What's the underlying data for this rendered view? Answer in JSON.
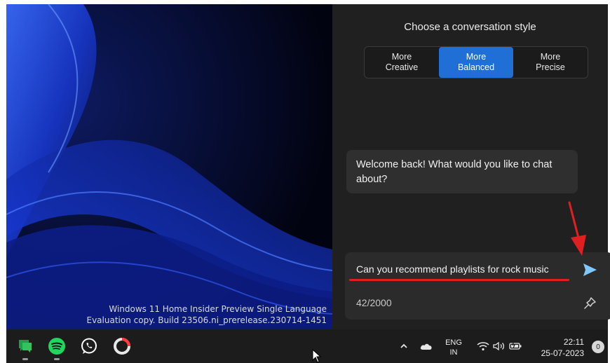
{
  "wallpaper": {
    "watermark_line1": "Windows 11 Home Insider Preview Single Language",
    "watermark_line2": "Evaluation copy. Build 23506.ni_prerelease.230714-1451"
  },
  "copilot": {
    "style_title": "Choose a conversation style",
    "styles": [
      {
        "line1": "More",
        "line2": "Creative",
        "active": false
      },
      {
        "line1": "More",
        "line2": "Balanced",
        "active": true
      },
      {
        "line1": "More",
        "line2": "Precise",
        "active": false
      }
    ],
    "message": "Welcome back! What would you like to chat about?",
    "input_value": "Can you recommend playlists for rock music",
    "char_count": "42/2000",
    "accent_color": "#1f6fd6",
    "annotation_color": "#e02020"
  },
  "taskbar": {
    "apps": [
      "google-chat-icon",
      "spotify-icon",
      "whatsapp-icon",
      "opera-icon"
    ],
    "lang_line1": "ENG",
    "lang_line2": "IN",
    "time": "22:11",
    "date": "25-07-2023",
    "notification_count": "0"
  }
}
